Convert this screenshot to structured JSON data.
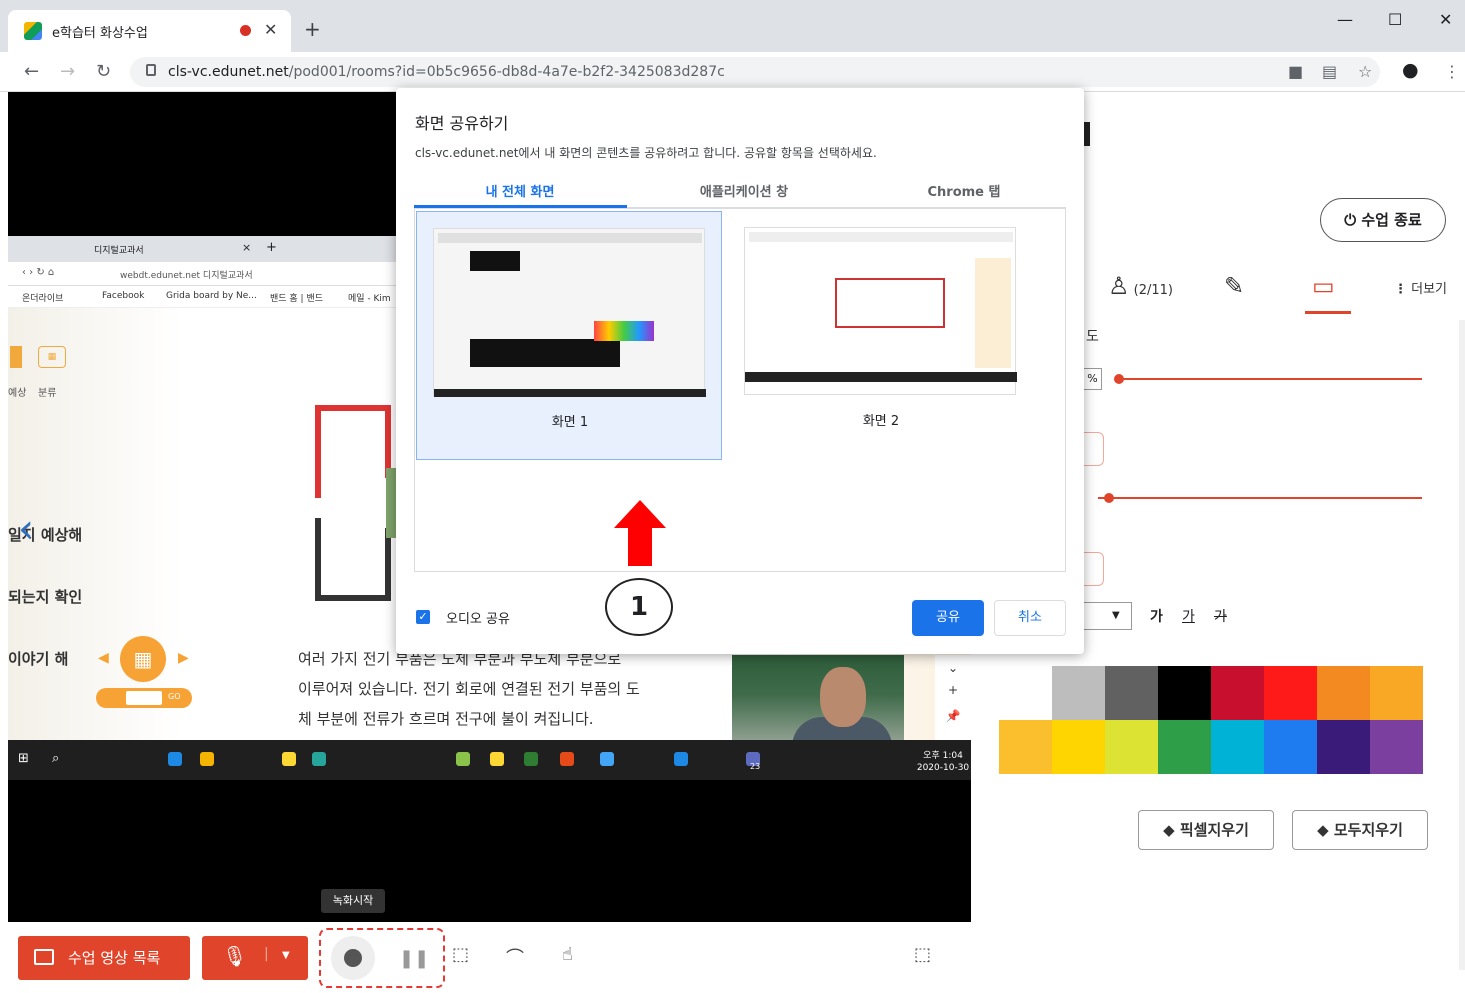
{
  "browser": {
    "tab_title": "e학습터 화상수업",
    "url_host": "cls-vc.edunet.net",
    "url_path": "/pod001/rooms?id=0b5c9656-db8d-4a7e-b2f2-3425083d287c"
  },
  "dialog": {
    "title": "화면 공유하기",
    "description": "cls-vc.edunet.net에서 내 화면의 콘텐츠를 공유하려고 합니다. 공유할 항목을 선택하세요.",
    "tabs": [
      "내 전체 화면",
      "애플리케이션 창",
      "Chrome 탭"
    ],
    "active_tab": "내 전체 화면",
    "screens": [
      {
        "label": "화면 1",
        "selected": true
      },
      {
        "label": "화면 2",
        "selected": false
      }
    ],
    "audio_share_label": "오디오 공유",
    "audio_share_checked": true,
    "share_button": "공유",
    "cancel_button": "취소"
  },
  "annotation": {
    "step_number": "1"
  },
  "shared_screen": {
    "tab_title": "디지털교과서",
    "address": "webdt.edunet.net 디지털교과서",
    "bookmarks": [
      "온더라이브",
      "Facebook",
      "Grida board by Ne...",
      "밴드 홈 | 밴드",
      "메일 - Kim"
    ],
    "side_icon_labels": [
      "예상",
      "분류"
    ],
    "side_texts": [
      "일지 예상해",
      "되는지 확인",
      "이야기 해"
    ],
    "paragraph_lines": [
      "여러 가지 전기 부품은 도체 부분과 부도체 부분으로",
      "이루어져 있습니다. 전기 회로에 연결된 전기 부품의 도",
      "체 부분에 전류가 흐르며 전구에 불이 켜집니다."
    ],
    "go_label": "GO",
    "taskbar_clock": [
      "오후 1:04",
      "2020-10-30"
    ],
    "taskbar_badge": "23"
  },
  "right_panel": {
    "end_class_button": "수업 종료",
    "participants_count": "(2/11)",
    "more_label": "더보기",
    "partial_label_top": "도",
    "percent_label": "%",
    "font_style_buttons": [
      "가",
      "가",
      "가"
    ],
    "palette_colors": [
      "#ffffff",
      "#bdbdbd",
      "#616161",
      "#000000",
      "#c8102e",
      "#ff1a1a",
      "#f28a21",
      "#f9a825",
      "#fbbf2e",
      "#ffd500",
      "#dde332",
      "#2e9e48",
      "#00b3d6",
      "#1e7cf0",
      "#3b1b7a",
      "#7b3fa0"
    ],
    "pixel_erase_button": "픽셀지우기",
    "all_erase_button": "모두지우기"
  },
  "toolbar": {
    "video_list_button": "수업 영상 목록",
    "record_tooltip": "녹화시작"
  }
}
